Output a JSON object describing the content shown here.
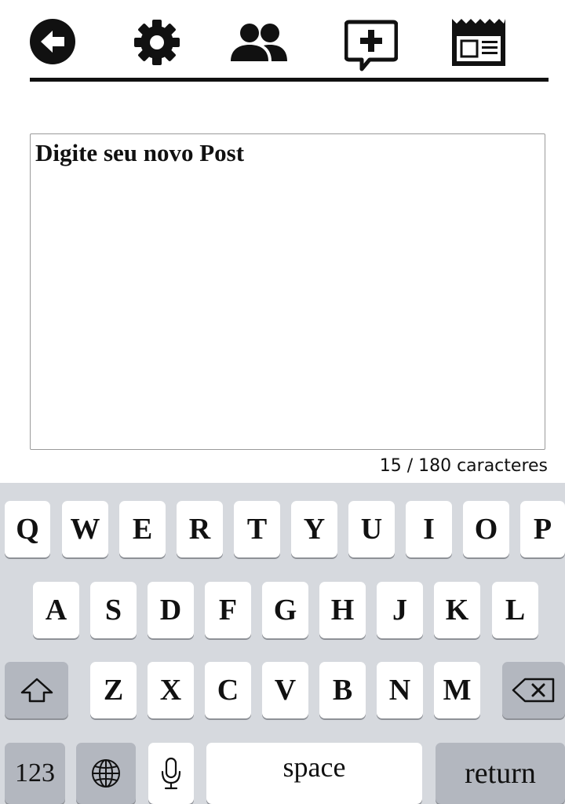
{
  "nav": {
    "icons": [
      "back-arrow-icon",
      "gear-icon",
      "people-icon",
      "add-comment-icon",
      "newspaper-icon"
    ]
  },
  "post": {
    "placeholder": "Digite seu novo Post",
    "counter": "15 / 180 caracteres"
  },
  "keyboard": {
    "row1": [
      "Q",
      "W",
      "E",
      "R",
      "T",
      "Y",
      "U",
      "I",
      "O",
      "P"
    ],
    "row2": [
      "A",
      "S",
      "D",
      "F",
      "G",
      "H",
      "J",
      "K",
      "L"
    ],
    "row3": [
      "Z",
      "X",
      "C",
      "V",
      "B",
      "N",
      "M"
    ],
    "numbers_label": "123",
    "space_label": "space",
    "return_label": "return"
  },
  "colors": {
    "keyboard_bg": "#d6d9de",
    "key_bg": "#ffffff",
    "function_key_bg": "#b3b7bf",
    "ink": "#111111"
  }
}
